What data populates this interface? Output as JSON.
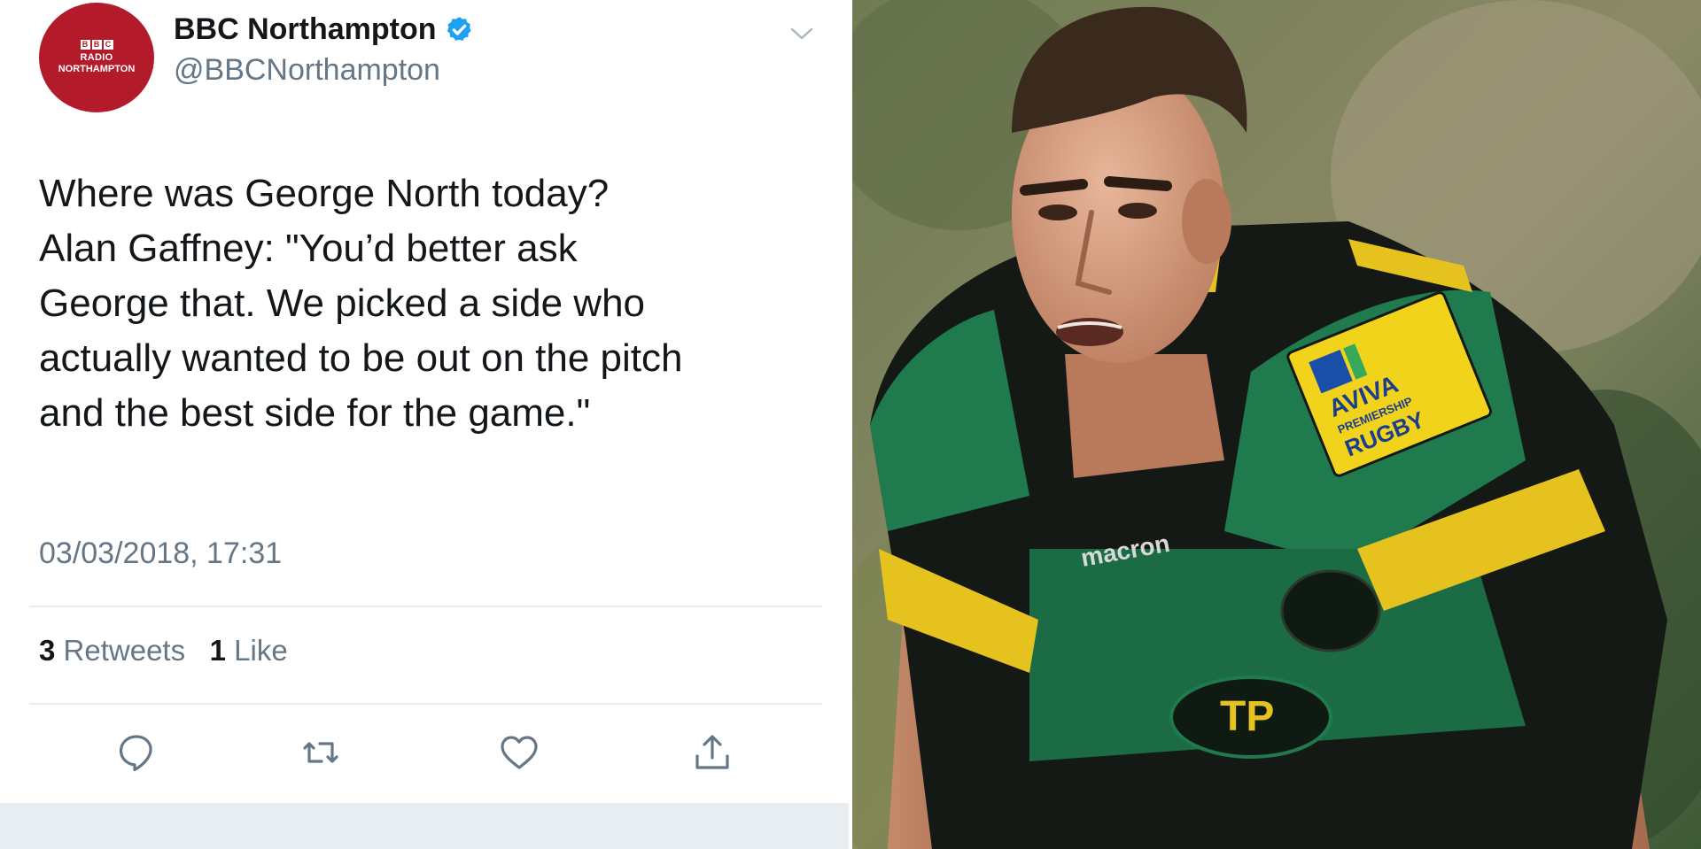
{
  "tweet": {
    "avatar": {
      "bbc_letters": [
        "B",
        "B",
        "C"
      ],
      "radio": "RADIO",
      "station": "NORTHAMPTON"
    },
    "account_name": "BBC Northampton",
    "handle": "@BBCNorthampton",
    "text_lines": [
      "Where was George North today?",
      "Alan Gaffney: \"You’d better ask",
      "George that. We picked a side who",
      "actually wanted to be out on the pitch",
      "and the best side for the game.\""
    ],
    "timestamp": "03/03/2018, 17:31",
    "retweets_count": "3",
    "retweets_label": "Retweets",
    "likes_count": "1",
    "likes_label": "Like",
    "icons": {
      "verified": "verified-badge-icon",
      "menu": "chevron-down-icon",
      "reply": "reply-icon",
      "retweet": "retweet-icon",
      "like": "heart-icon",
      "share": "share-icon"
    }
  },
  "photo": {
    "description_icon": "rugby-player-photo",
    "colors": {
      "jersey_green": "#1f7a4d",
      "jersey_black": "#151915",
      "jersey_gold": "#e6c21e",
      "avatar_red": "#b31b2a",
      "verified_blue": "#1da1f2"
    },
    "sponsor_badge": {
      "word1": "AVIVA",
      "word2": "PREMIERSHIP",
      "word3": "RUGBY"
    },
    "chest_logo": "macron"
  }
}
